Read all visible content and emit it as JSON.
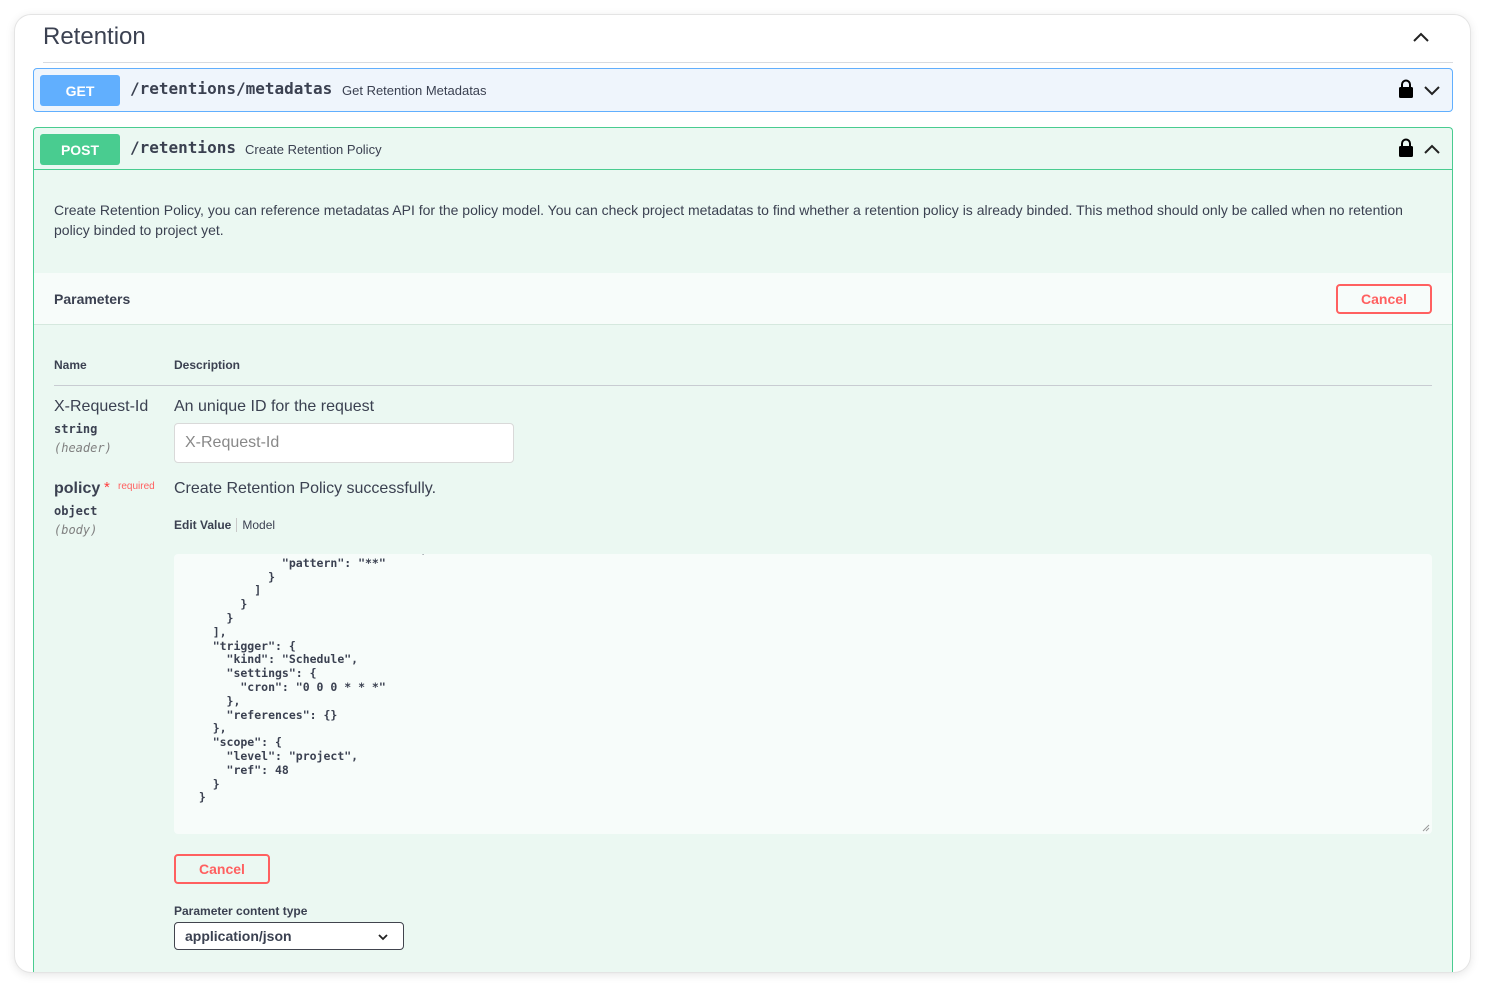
{
  "tag": {
    "title": "Retention"
  },
  "get_op": {
    "method": "GET",
    "path": "/retentions/metadatas",
    "summary": "Get Retention Metadatas"
  },
  "post_op": {
    "method": "POST",
    "path": "/retentions",
    "summary": "Create Retention Policy",
    "description": "Create Retention Policy, you can reference metadatas API for the policy model. You can check project metadatas to find whether a retention policy is already binded. This method should only be called when no retention policy binded to project yet.",
    "parameters_title": "Parameters",
    "cancel_label": "Cancel",
    "columns": {
      "name": "Name",
      "description": "Description"
    },
    "params": [
      {
        "name": "X-Request-Id",
        "type": "string",
        "in": "(header)",
        "description": "An unique ID for the request",
        "placeholder": "X-Request-Id"
      },
      {
        "name": "policy",
        "required_mark": "*",
        "required_text": "required",
        "type": "object",
        "in": "(body)",
        "description": "Create Retention Policy successfully.",
        "tabs": {
          "edit": "Edit Value",
          "model": "Model"
        },
        "value": "              \"kind\": \"doublestar\",\n              \"pattern\": \"**\"\n            }\n          ]\n        }\n      }\n    ],\n    \"trigger\": {\n      \"kind\": \"Schedule\",\n      \"settings\": {\n        \"cron\": \"0 0 0 * * *\"\n      },\n      \"references\": {}\n    },\n    \"scope\": {\n      \"level\": \"project\",\n      \"ref\": 48\n    }\n  }",
        "cancel_label": "Cancel"
      }
    ],
    "content_type_label": "Parameter content type",
    "content_type_value": "application/json"
  }
}
